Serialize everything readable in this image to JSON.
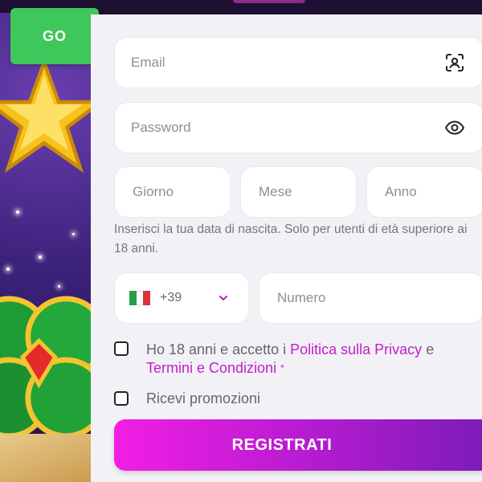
{
  "go_button": {
    "label": "GO"
  },
  "form": {
    "email": {
      "placeholder": "Email",
      "icon": "contact-scan-icon"
    },
    "password": {
      "placeholder": "Password",
      "icon": "eye-icon"
    },
    "birth": {
      "day_placeholder": "Giorno",
      "month_placeholder": "Mese",
      "year_placeholder": "Anno",
      "hint": "Inserisci la tua data di nascita. Solo per utenti di età superiore ai 18 anni."
    },
    "phone": {
      "country_flag": "italy-flag-icon",
      "prefix": "+39",
      "number_placeholder": "Numero"
    },
    "terms": {
      "text_before": "Ho 18 anni e accetto i ",
      "privacy_link": "Politica sulla Privacy",
      "text_middle": " e ",
      "terms_link": "Termini e Condizioni",
      "required_mark": "*"
    },
    "promotions": {
      "label": "Ricevi promozioni"
    },
    "submit": {
      "label": "REGISTRATI"
    }
  },
  "colors": {
    "go_green": "#3ec75a",
    "link_magenta": "#c21fc6",
    "button_gradient_start": "#f21ee5",
    "button_gradient_end": "#7a1cb6",
    "panel_bg": "#f2f1f6"
  }
}
